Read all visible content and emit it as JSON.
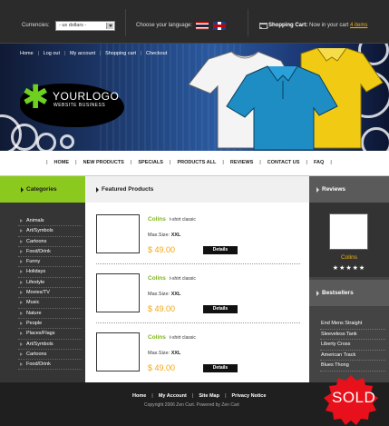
{
  "topbar": {
    "currencies_label": "Currencies:",
    "currency_selected": "- us dollars -",
    "language_label": "Choose your language:",
    "cart_label": "Shopping Cart:",
    "cart_text": "Now in your cart",
    "cart_items": "4 items"
  },
  "header": {
    "nav": [
      "Home",
      "Log out",
      "My account",
      "Shopping cart",
      "Checkout"
    ],
    "logo_text": "YOURLOGO",
    "logo_sub": "WEBSITE BUSINESS"
  },
  "mainnav": [
    "HOME",
    "NEW PRODUCTS",
    "SPECIALS",
    "PRODUCTS ALL",
    "REVIEWS",
    "CONTACT US",
    "FAQ"
  ],
  "categories": {
    "title": "Categories",
    "items": [
      "Animals",
      "Art/Symbols",
      "Cartoons",
      "Food/Drink",
      "Funny",
      "Holidays",
      "Lifestyle",
      "Movies/TV",
      "Music",
      "Nature",
      "People",
      "Places/Flags",
      "Art/Symbols",
      "Cartoons",
      "Food/Drink"
    ]
  },
  "featured": {
    "title": "Featured Products",
    "products": [
      {
        "name": "Colins",
        "desc": "t-shirt classic",
        "size_label": "Max.Size:",
        "size": "XXL",
        "price": "$ 49.00",
        "button": "Details"
      },
      {
        "name": "Colins",
        "desc": "t-shirt classic",
        "size_label": "Max.Size:",
        "size": "XXL",
        "price": "$ 49.00",
        "button": "Details"
      },
      {
        "name": "Colins",
        "desc": "t-shirt classic",
        "size_label": "Max.Size:",
        "size": "XXL",
        "price": "$ 49.00",
        "button": "Details"
      }
    ]
  },
  "reviews": {
    "title": "Reviews",
    "name": "Colins",
    "stars": "★★★★★"
  },
  "bestsellers": {
    "title": "Bestsellers",
    "items": [
      "End Mens Straight",
      "Sleeveless Tank",
      "Liberty Cross",
      "American Track",
      "Blues Thong"
    ]
  },
  "footer": {
    "links": [
      "Home",
      "My Account",
      "Site Map",
      "Privacy Notice"
    ],
    "copyright": "Copyright  2006 Zen Cart. Powered by Zen Cart"
  },
  "sold_label": "SOLD",
  "colors": {
    "accent_green": "#8cc91e",
    "price_orange": "#f2a714",
    "sold_red": "#e8101a"
  }
}
